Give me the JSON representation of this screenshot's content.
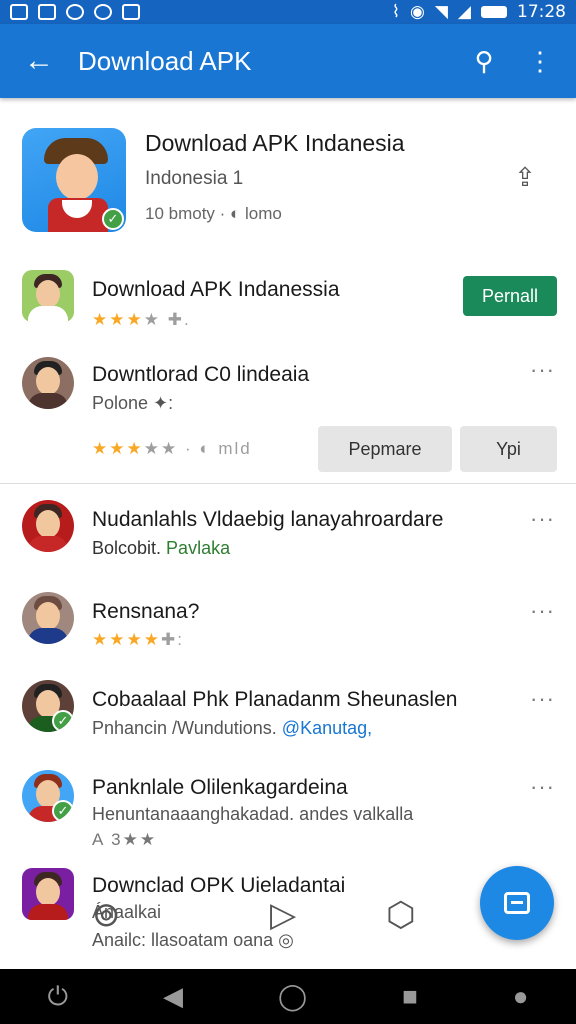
{
  "status": {
    "time": "17:28",
    "left_icons": [
      "gallery-icon",
      "photo-icon",
      "messenger-icon",
      "mail-icon",
      "check-icon"
    ],
    "right_icons": [
      "vibrate-icon",
      "alarm-icon",
      "wifi-icon",
      "signal-icon",
      "battery-icon"
    ]
  },
  "appbar": {
    "title": "Download APK",
    "back": "←",
    "search": "⚲",
    "menu": "⋮"
  },
  "hero": {
    "title": "Download APK Indanesia",
    "subtitle": "Indonesia 1",
    "meta": "10 bmoty · ◐ lomo",
    "share": "⇪"
  },
  "apps": [
    {
      "title": "Download APK Indanessia",
      "stars": "★★★",
      "stars_dim": "★",
      "stars_tail": " ✚.",
      "install_label": "Pernall"
    },
    {
      "title": "Downtlorad C0 lindeaia",
      "sub": "Polone ✦:",
      "stars": "★★★",
      "stars_dim": "★★",
      "stars_tail": " · ◐ mld",
      "btn_a": "Pepmare",
      "btn_b": "Ypi"
    }
  ],
  "list": [
    {
      "title": "Nudanlahls Vldaebig lanayahroardare",
      "sub_a": "Bolcobit.",
      "sub_b": " Pavlaka"
    },
    {
      "title": "Rensnana?",
      "stars": "★★★★",
      "stars_tail": "✚:"
    },
    {
      "title": "Cobaalaal Phk Planadanm Sheunaslen",
      "sub_a": "Pnhancin /Wundutions.",
      "sub_b": " @Kanutag,"
    },
    {
      "title": "Panknlale Olilenkagardeina",
      "sub_a": "Henuntanaaanghakadad. andes valkalla",
      "stars_text": "A 3★★"
    },
    {
      "title": "Downclad OPK Uieladantai",
      "sub_a": "Ánaalkai",
      "sub_b": "Anailc: llasoatam oana ◎"
    }
  ],
  "more": "···",
  "nav": {
    "home_btn": "⏻",
    "back_btn": "◀",
    "circle_btn": "◯",
    "square_btn": "■",
    "profile_btn": "●"
  }
}
